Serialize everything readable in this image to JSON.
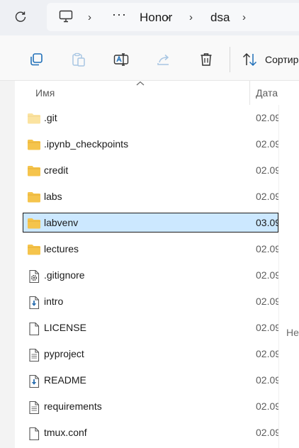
{
  "address_bar": {
    "overflow": "···",
    "breadcrumbs": [
      "Honor",
      "dsa"
    ]
  },
  "toolbar": {
    "sort_label": "Сортир",
    "icons": [
      "copy-icon",
      "paste-icon",
      "rename-icon",
      "share-icon",
      "delete-icon",
      "sort-icon"
    ]
  },
  "list_header": {
    "name": "Имя",
    "date": "Дата"
  },
  "files": [
    {
      "name": ".git",
      "date": "02.09",
      "type": "folder-light"
    },
    {
      "name": ".ipynb_checkpoints",
      "date": "02.09",
      "type": "folder"
    },
    {
      "name": "credit",
      "date": "02.09",
      "type": "folder"
    },
    {
      "name": "labs",
      "date": "02.09",
      "type": "folder"
    },
    {
      "name": "labvenv",
      "date": "03.09",
      "type": "folder",
      "selected": true
    },
    {
      "name": "lectures",
      "date": "02.09",
      "type": "folder"
    },
    {
      "name": ".gitignore",
      "date": "02.09",
      "type": "settings-file"
    },
    {
      "name": "intro",
      "date": "02.09",
      "type": "download-file"
    },
    {
      "name": "LICENSE",
      "date": "02.09",
      "type": "blank-file"
    },
    {
      "name": "pyproject",
      "date": "02.09",
      "type": "text-file"
    },
    {
      "name": "README",
      "date": "02.09",
      "type": "download-file"
    },
    {
      "name": "requirements",
      "date": "02.09",
      "type": "text-file"
    },
    {
      "name": "tmux.conf",
      "date": "02.09",
      "type": "blank-file"
    }
  ],
  "preview_pane": {
    "text": "Не"
  },
  "colors": {
    "folder": "#f5c44c",
    "folder_light": "#fbe3a0",
    "selection": "#cce8ff",
    "accent": "#1f6fb8"
  }
}
